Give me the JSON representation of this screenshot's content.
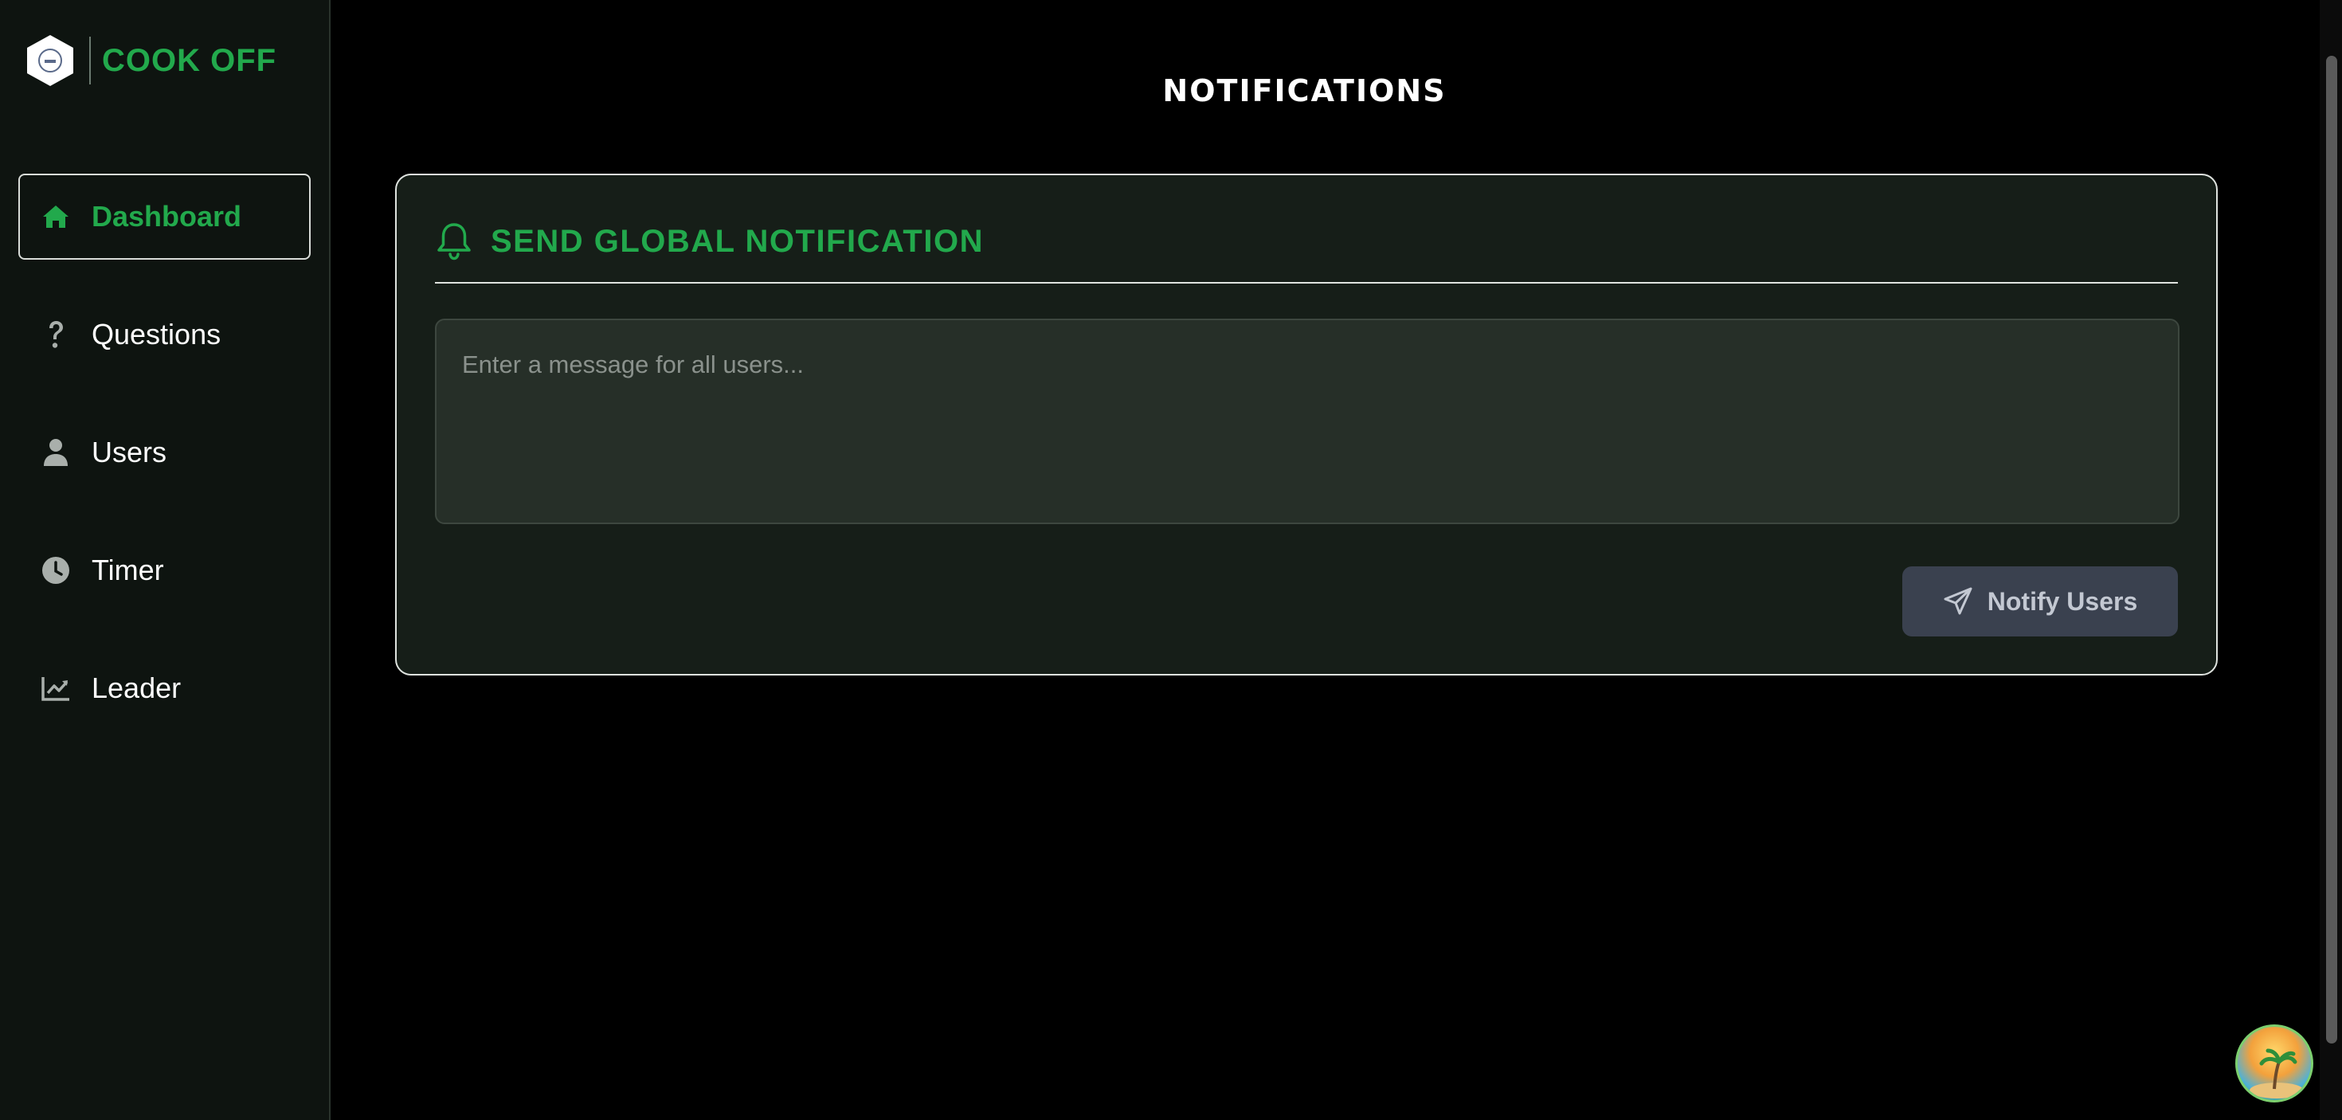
{
  "brand": {
    "name": "COOK OFF"
  },
  "sidebar": {
    "items": [
      {
        "label": "Dashboard",
        "icon": "home-icon",
        "active": true
      },
      {
        "label": "Questions",
        "icon": "question-icon",
        "active": false
      },
      {
        "label": "Users",
        "icon": "user-icon",
        "active": false
      },
      {
        "label": "Timer",
        "icon": "clock-icon",
        "active": false
      },
      {
        "label": "Leader",
        "icon": "chart-line-icon",
        "active": false
      }
    ]
  },
  "page": {
    "title": "NOTIFICATIONS"
  },
  "card": {
    "title": "SEND GLOBAL NOTIFICATION",
    "icon": "bell-icon",
    "message_placeholder": "Enter a message for all users...",
    "message_value": "",
    "button_label": "Notify Users",
    "button_icon": "send-icon"
  },
  "colors": {
    "accent": "#22a94c",
    "background": "#000000",
    "sidebar": "#0e1410",
    "card": "#161e18",
    "input": "#262f28",
    "button_disabled": "#3a414f"
  }
}
